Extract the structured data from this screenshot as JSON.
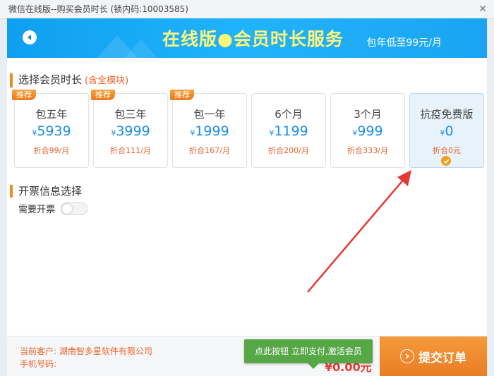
{
  "window": {
    "title": "微信在线版--购买会员时长 (锁内码:10003585)"
  },
  "banner": {
    "title": "在线版●会员时长服务",
    "subtitle": "包年低至99元/月"
  },
  "section_duration": {
    "title": "选择会员时长",
    "hint": "(含全模块)"
  },
  "plans": [
    {
      "badge": "推荐",
      "name": "包五年",
      "currency": "¥",
      "price": "5939",
      "per_month": "折合99/月",
      "selected": false
    },
    {
      "badge": "推荐",
      "name": "包三年",
      "currency": "¥",
      "price": "3999",
      "per_month": "折合111/月",
      "selected": false
    },
    {
      "badge": "推荐",
      "name": "包一年",
      "currency": "¥",
      "price": "1999",
      "per_month": "折合167/月",
      "selected": false
    },
    {
      "badge": "",
      "name": "6个月",
      "currency": "¥",
      "price": "1199",
      "per_month": "折合200/月",
      "selected": false
    },
    {
      "badge": "",
      "name": "3个月",
      "currency": "¥",
      "price": "999",
      "per_month": "折合333/月",
      "selected": false
    },
    {
      "badge": "",
      "name": "抗疫免费版",
      "currency": "¥",
      "price": "0",
      "per_month": "折合0元",
      "selected": true
    }
  ],
  "section_invoice": {
    "title": "开票信息选择",
    "toggle_label": "需要开票",
    "toggle_on": false
  },
  "footer": {
    "customer_label": "当前客户:",
    "customer_value": "湖南智多星软件有限公司",
    "phone_label": "手机号码:",
    "phone_value": "",
    "total": "¥0.00元",
    "tooltip": "点此按钮 立即支付,激活会员",
    "submit_label": "提交订单"
  },
  "colors": {
    "banner": "#21b3fb",
    "accent_orange": "#ea7d23",
    "price_blue": "#1a8fe3",
    "tooltip_green": "#56a846",
    "annotation_arrow": "#e53935"
  },
  "icons": [
    "back-arrow-icon",
    "check-icon",
    "submit-arrow-icon",
    "close-icon"
  ]
}
